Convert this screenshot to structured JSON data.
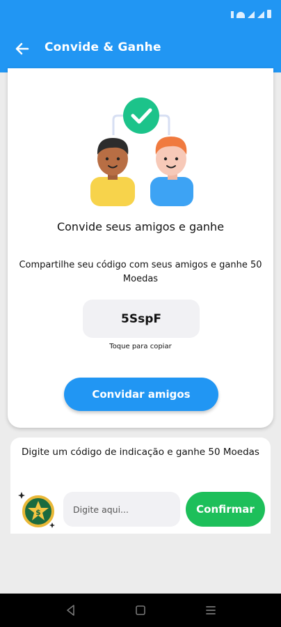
{
  "header": {
    "title": "Convide & Ganhe",
    "background_color": "#2196f3",
    "back_icon": "arrow-left-icon"
  },
  "invite_card": {
    "headline": "Convide seus amigos e ganhe",
    "description": "Compartilhe seu código com seus amigos e ganhe 50 Moedas",
    "referral_code": "5SspF",
    "copy_hint": "Toque para copiar",
    "invite_button_label": "Convidar amigos",
    "check_color": "#1cc38a"
  },
  "redeem_card": {
    "instruction": "Digite um código de indicação e ganhe 50 Moedas",
    "input_placeholder": "Digite aqui...",
    "input_value": "",
    "confirm_button_label": "Confirmar",
    "confirm_color": "#1dbf5a",
    "coin_icon": "dollar-coin-icon"
  },
  "nav_bar": {
    "icons": [
      "back-triangle-icon",
      "home-square-icon",
      "recents-menu-icon"
    ]
  }
}
